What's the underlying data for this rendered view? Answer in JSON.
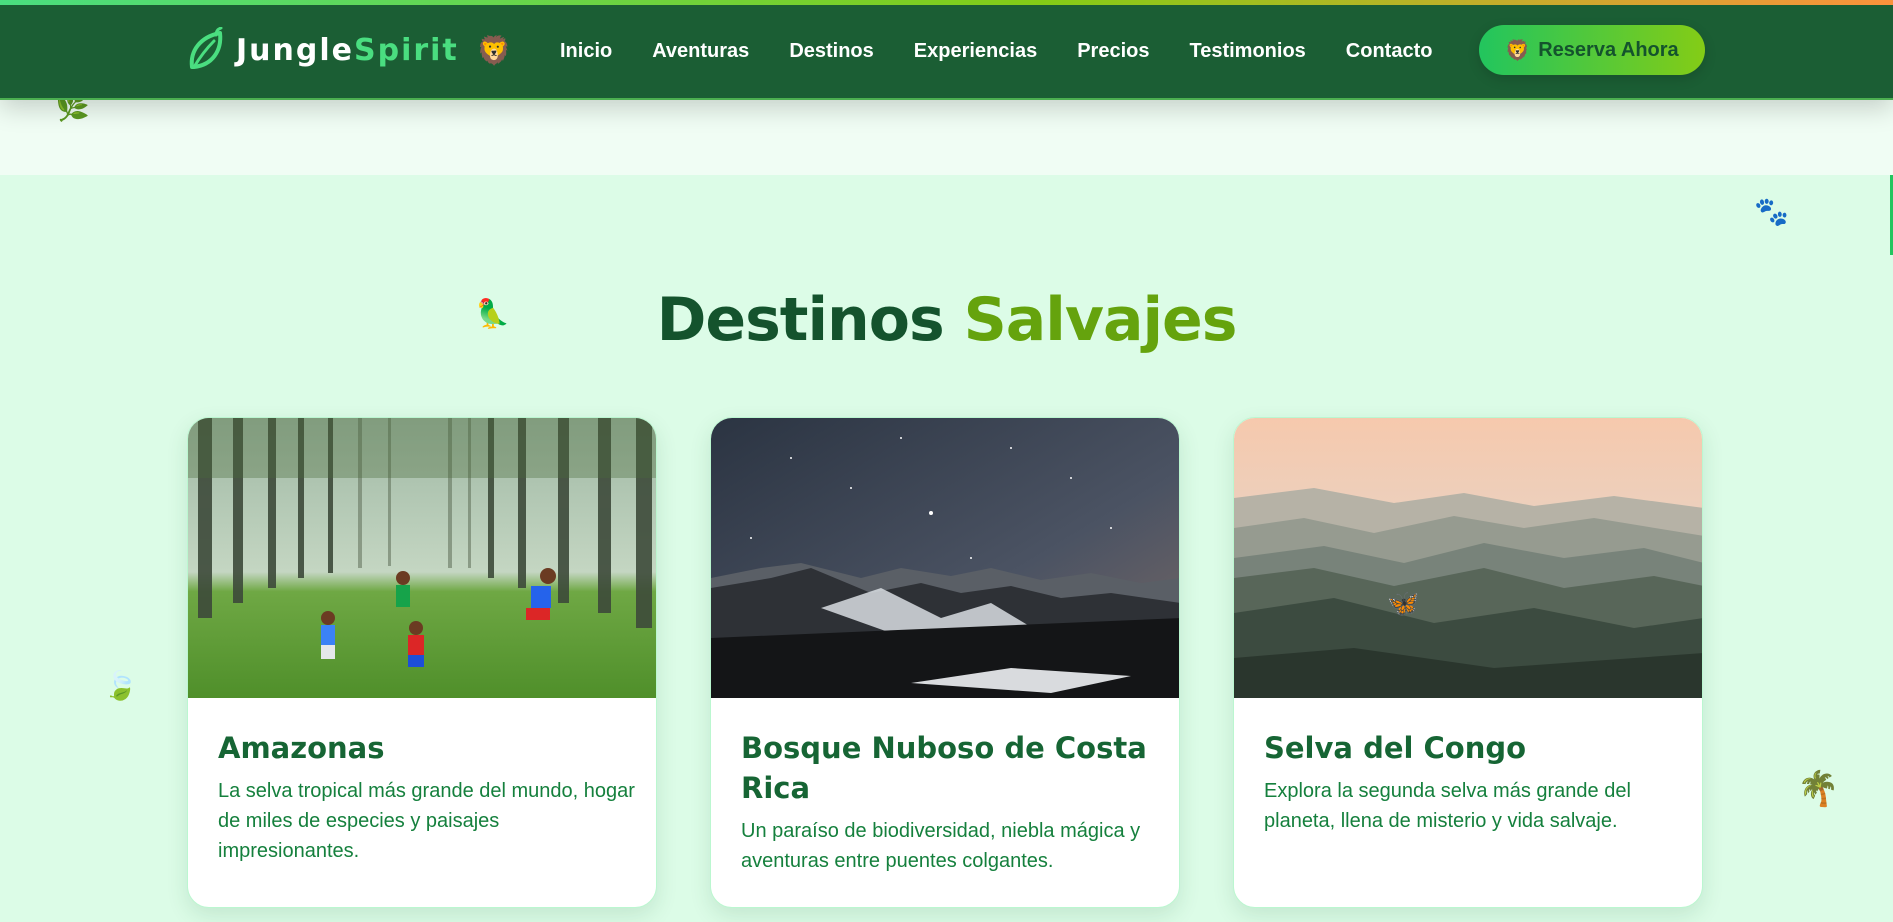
{
  "brand": {
    "name_part1": "Jungle",
    "name_part2": "Spirit",
    "emoji": "🦁",
    "logo_icon": "leaf-icon"
  },
  "nav": {
    "items": [
      {
        "label": "Inicio"
      },
      {
        "label": "Aventuras"
      },
      {
        "label": "Destinos"
      },
      {
        "label": "Experiencias"
      },
      {
        "label": "Precios"
      },
      {
        "label": "Testimonios"
      },
      {
        "label": "Contacto"
      }
    ],
    "cta": {
      "emoji": "🦁",
      "label": "Reserva Ahora"
    }
  },
  "section": {
    "title_part1": "Destinos",
    "title_part2": "Salvajes"
  },
  "cards": [
    {
      "title": "Amazonas",
      "description": "La selva tropical más grande del mundo, hogar de miles de especies y paisajes impresionantes.",
      "image": "children-playing-in-forest"
    },
    {
      "title": "Bosque Nuboso de Costa Rica",
      "description": "Un paraíso de biodiversidad, niebla mágica y aventuras entre puentes colgantes.",
      "image": "starry-night-over-mountains"
    },
    {
      "title": "Selva del Congo",
      "description": "Explora la segunda selva más grande del planeta, llena de misterio y vida salvaje.",
      "image": "misty-mountain-ridges-sunset"
    }
  ],
  "decorations": {
    "leaf_top": "🌿",
    "paw": "🐾",
    "parrot": "🦜",
    "leaf_left": "🍃",
    "butterfly": "🦋",
    "palm": "🌴"
  },
  "colors": {
    "header_bg": "#1b5e34",
    "page_bg": "#dcfce7",
    "accent_green": "#4ade80",
    "title_dark": "#14532d",
    "title_accent": "#65a30d"
  }
}
